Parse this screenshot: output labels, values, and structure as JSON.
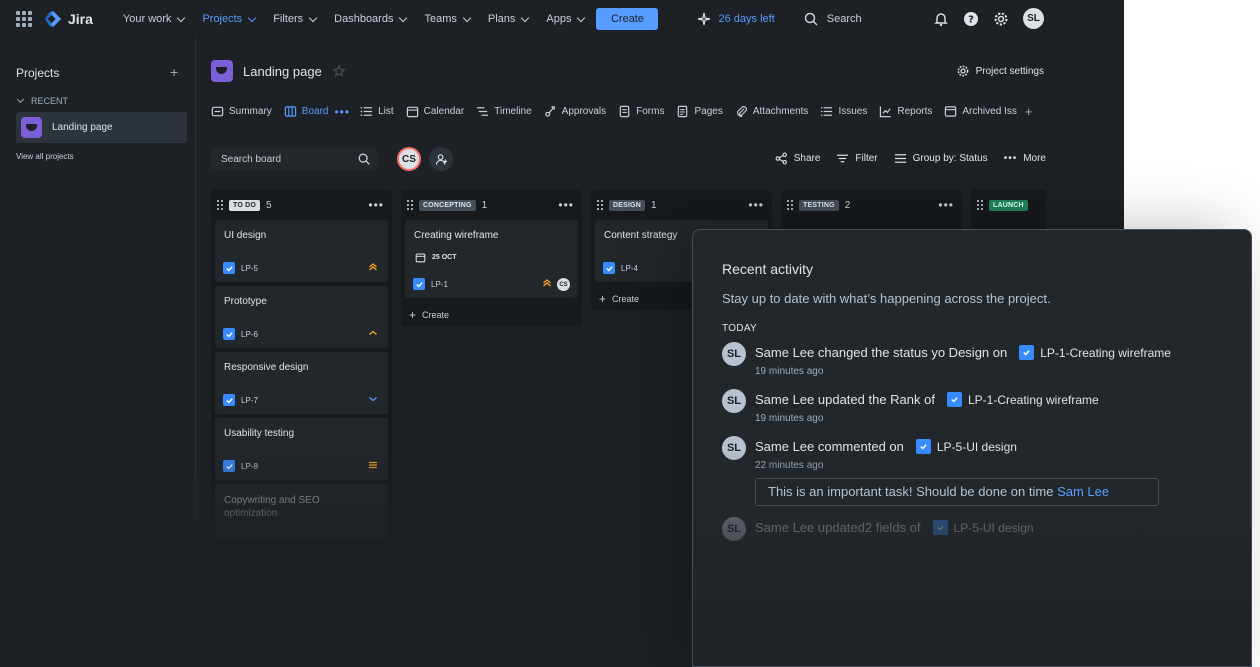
{
  "topnav": {
    "logo": "Jira",
    "items": [
      {
        "label": "Your work"
      },
      {
        "label": "Projects"
      },
      {
        "label": "Filters"
      },
      {
        "label": "Dashboards"
      },
      {
        "label": "Teams"
      },
      {
        "label": "Plans"
      },
      {
        "label": "Apps"
      }
    ],
    "create_label": "Create",
    "trial_label": "26 days left",
    "search_label": "Search",
    "user_initials": "SL"
  },
  "sidebar": {
    "heading": "Projects",
    "add_label": "+",
    "recent_label": "RECENT",
    "project_name": "Landing page",
    "view_all": "View all projects"
  },
  "project": {
    "name": "Landing page",
    "settings_label": "Project settings"
  },
  "tabs": [
    {
      "label": "Summary",
      "icon": "summary-icon"
    },
    {
      "label": "Board",
      "icon": "board-icon"
    },
    {
      "label": "List",
      "icon": "list-icon"
    },
    {
      "label": "Calendar",
      "icon": "calendar-icon"
    },
    {
      "label": "Timeline",
      "icon": "timeline-icon"
    },
    {
      "label": "Approvals",
      "icon": "approvals-icon"
    },
    {
      "label": "Forms",
      "icon": "forms-icon"
    },
    {
      "label": "Pages",
      "icon": "pages-icon"
    },
    {
      "label": "Attachments",
      "icon": "attachment-icon"
    },
    {
      "label": "Issues",
      "icon": "issues-icon"
    },
    {
      "label": "Reports",
      "icon": "reports-icon"
    },
    {
      "label": "Archived Iss",
      "icon": "archive-icon"
    }
  ],
  "toolbar": {
    "search_placeholder": "Search board",
    "cs_initials": "CS",
    "share_label": "Share",
    "filter_label": "Filter",
    "group_label": "Group by: Status",
    "more_label": "More"
  },
  "columns": [
    {
      "status": "TO DO",
      "count": "5",
      "cards": [
        {
          "title": "UI design",
          "key": "LP-5",
          "priority": "high"
        },
        {
          "title": "Prototype",
          "key": "LP-6",
          "priority": "medium-high"
        },
        {
          "title": "Responsive design",
          "key": "LP-7",
          "priority": "low"
        },
        {
          "title": "Usability testing",
          "key": "LP-8",
          "priority": "medium"
        },
        {
          "title": "Copywriting and SEO optimization",
          "key": "",
          "priority": ""
        }
      ]
    },
    {
      "status": "CONCEPTING",
      "count": "1",
      "cards": [
        {
          "title": "Creating wireframe",
          "key": "LP-1",
          "date": "25 OCT",
          "assignee": "CS",
          "priority": "high"
        }
      ],
      "create_label": "Create"
    },
    {
      "status": "DESIGN",
      "count": "1",
      "cards": [
        {
          "title": "Content strategy",
          "key": "LP-4"
        }
      ],
      "create_label": "Create"
    },
    {
      "status": "TESTING",
      "count": "2",
      "cards": []
    },
    {
      "status": "LAUNCH",
      "count": "",
      "cards": []
    }
  ],
  "activity": {
    "title": "Recent activity",
    "subtitle": "Stay up to date with what’s happening across the project.",
    "today": "TODAY",
    "items": [
      {
        "initials": "SL",
        "text": "Same Lee changed the status yo Design on",
        "issue": "LP-1-Creating wireframe",
        "time": "19 minutes ago"
      },
      {
        "initials": "SL",
        "text": "Same Lee updated the Rank of",
        "issue": "LP-1-Creating wireframe",
        "time": "19 minutes ago"
      },
      {
        "initials": "SL",
        "text": "Same Lee commented on",
        "issue": "LP-5-UI design",
        "time": "22 minutes ago"
      },
      {
        "initials": "SL",
        "text": "Same Lee updated2 fields of",
        "issue": "LP-5-UI design",
        "time": ""
      }
    ],
    "comment_text": "This is an important task! Should be done on time",
    "comment_mention": "Sam Lee"
  },
  "colors": {
    "accent": "#579dff",
    "background": "#1d2125",
    "card": "#22272b",
    "priority_high": "#f5a623",
    "priority_low": "#579dff"
  }
}
